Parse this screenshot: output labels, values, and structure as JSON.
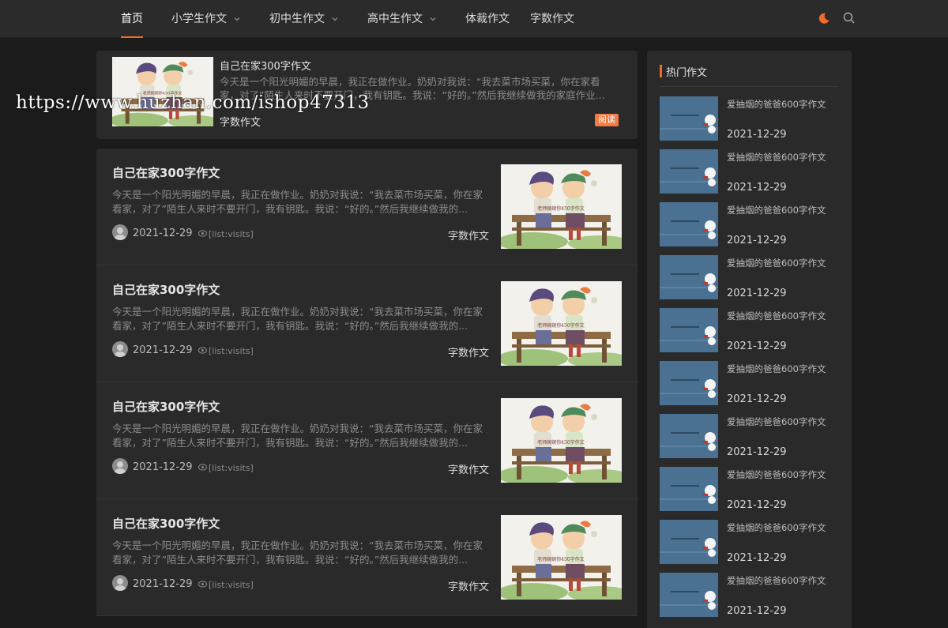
{
  "colors": {
    "accent": "#f06a2a",
    "page_bg": "#1b1b1c",
    "card_bg": "#2a2a2b",
    "nav_bg": "#2b2b2c",
    "badge": "#f07b43",
    "hot_thumb": "#4a7092"
  },
  "nav": {
    "items": [
      {
        "label": "首页",
        "active": true,
        "dropdown": false
      },
      {
        "label": "小学生作文",
        "active": false,
        "dropdown": true
      },
      {
        "label": "初中生作文",
        "active": false,
        "dropdown": true
      },
      {
        "label": "高中生作文",
        "active": false,
        "dropdown": true
      },
      {
        "label": "体裁作文",
        "active": false,
        "dropdown": false
      },
      {
        "label": "字数作文",
        "active": false,
        "dropdown": false
      }
    ],
    "icons": [
      "moon-icon",
      "search-icon"
    ]
  },
  "watermark": "https://www.huzhan.com/ishop47313",
  "featured": {
    "title": "自己在家300字作文",
    "excerpt": "今天是一个阳光明媚的早晨，我正在做作业。奶奶对我说：“我去菜市场买菜，你在家看家，对了”陌生人来时不要开门，我有钥匙。我说：“好的。”然后我继续做我的家庭作业...",
    "category": "字数作文",
    "badge": "阅读"
  },
  "posts": [
    {
      "title": "自己在家300字作文",
      "excerpt": "今天是一个阳光明媚的早晨，我正在做作业。奶奶对我说：“我去菜市场买菜，你在家看家，对了”陌生人来时不要开门，我有钥匙。我说：“好的。”然后我继续做我的...",
      "date": "2021-12-29",
      "visits": "[list:visits]",
      "category": "字数作文"
    },
    {
      "title": "自己在家300字作文",
      "excerpt": "今天是一个阳光明媚的早晨，我正在做作业。奶奶对我说：“我去菜市场买菜，你在家看家，对了”陌生人来时不要开门，我有钥匙。我说：“好的。”然后我继续做我的...",
      "date": "2021-12-29",
      "visits": "[list:visits]",
      "category": "字数作文"
    },
    {
      "title": "自己在家300字作文",
      "excerpt": "今天是一个阳光明媚的早晨，我正在做作业。奶奶对我说：“我去菜市场买菜，你在家看家，对了”陌生人来时不要开门，我有钥匙。我说：“好的。”然后我继续做我的...",
      "date": "2021-12-29",
      "visits": "[list:visits]",
      "category": "字数作文"
    },
    {
      "title": "自己在家300字作文",
      "excerpt": "今天是一个阳光明媚的早晨，我正在做作业。奶奶对我说：“我去菜市场买菜，你在家看家，对了”陌生人来时不要开门，我有钥匙。我说：“好的。”然后我继续做我的...",
      "date": "2021-12-29",
      "visits": "[list:visits]",
      "category": "字数作文"
    }
  ],
  "sidebar": {
    "title": "热门作文",
    "items": [
      {
        "title": "爱抽烟的爸爸600字作文",
        "date": "2021-12-29"
      },
      {
        "title": "爱抽烟的爸爸600字作文",
        "date": "2021-12-29"
      },
      {
        "title": "爱抽烟的爸爸600字作文",
        "date": "2021-12-29"
      },
      {
        "title": "爱抽烟的爸爸600字作文",
        "date": "2021-12-29"
      },
      {
        "title": "爱抽烟的爸爸600字作文",
        "date": "2021-12-29"
      },
      {
        "title": "爱抽烟的爸爸600字作文",
        "date": "2021-12-29"
      },
      {
        "title": "爱抽烟的爸爸600字作文",
        "date": "2021-12-29"
      },
      {
        "title": "爱抽烟的爸爸600字作文",
        "date": "2021-12-29"
      },
      {
        "title": "爱抽烟的爸爸600字作文",
        "date": "2021-12-29"
      },
      {
        "title": "爱抽烟的爸爸600字作文",
        "date": "2021-12-29"
      }
    ]
  }
}
